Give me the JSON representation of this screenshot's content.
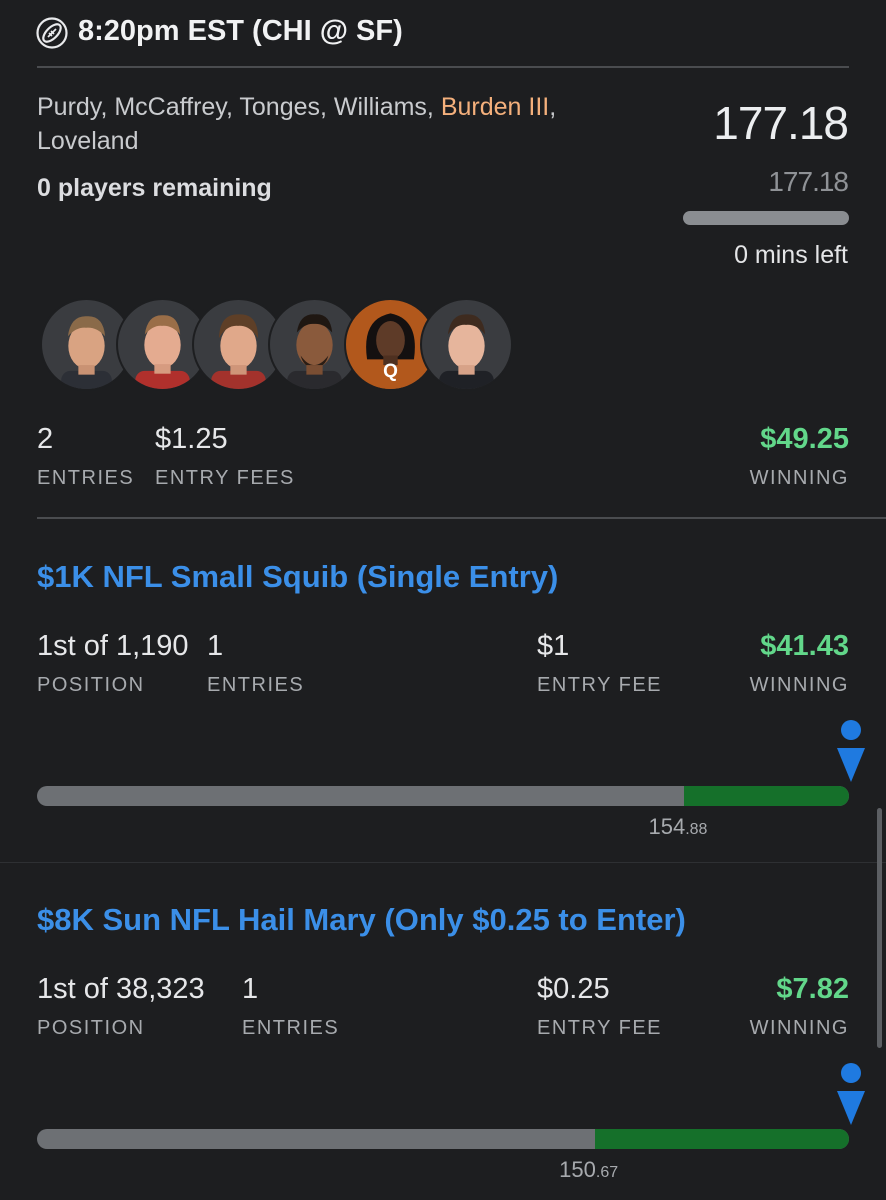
{
  "header": {
    "game": "8:20pm EST (CHI @ SF)"
  },
  "lineup": {
    "players_before": "Purdy, McCaffrey, Tonges, Williams, ",
    "players_highlight": "Burden III",
    "players_after": ", Loveland",
    "remaining": "0 players remaining",
    "score": "177.18",
    "projected": "177.18",
    "progress": 1.0,
    "time_left": "0 mins left",
    "avatars": [
      {
        "name": "Purdy"
      },
      {
        "name": "McCaffrey"
      },
      {
        "name": "Tonges"
      },
      {
        "name": "Williams"
      },
      {
        "name": "Burden III",
        "badge": "Q"
      },
      {
        "name": "Loveland"
      }
    ],
    "entries": "2",
    "entries_label": "ENTRIES",
    "fees": "$1.25",
    "fees_label": "ENTRY FEES",
    "winning": "$49.25",
    "winning_label": "WINNING"
  },
  "contests": [
    {
      "title": "$1K NFL Small Squib (Single Entry)",
      "position": "1st of 1,190",
      "position_label": "POSITION",
      "entries": "1",
      "entries_label": "ENTRIES",
      "fee": "$1",
      "fee_label": "ENTRY FEE",
      "winning": "$41.43",
      "winning_label": "WINNING",
      "cutoff_whole": "154",
      "cutoff_decimal": ".88",
      "cutoff_fraction": 0.79
    },
    {
      "title": "$8K Sun NFL Hail Mary (Only $0.25 to Enter)",
      "position": "1st of 38,323",
      "position_label": "POSITION",
      "entries": "1",
      "entries_label": "ENTRIES",
      "fee": "$0.25",
      "fee_label": "ENTRY FEE",
      "winning": "$7.82",
      "winning_label": "WINNING",
      "cutoff_whole": "150",
      "cutoff_decimal": ".67",
      "cutoff_fraction": 0.68
    }
  ],
  "colors": {
    "accent": "#3b8fe8",
    "winning": "#62d78a",
    "highlight": "#f4b07c",
    "bar_green": "#15702a",
    "marker": "#1f7ae0"
  }
}
